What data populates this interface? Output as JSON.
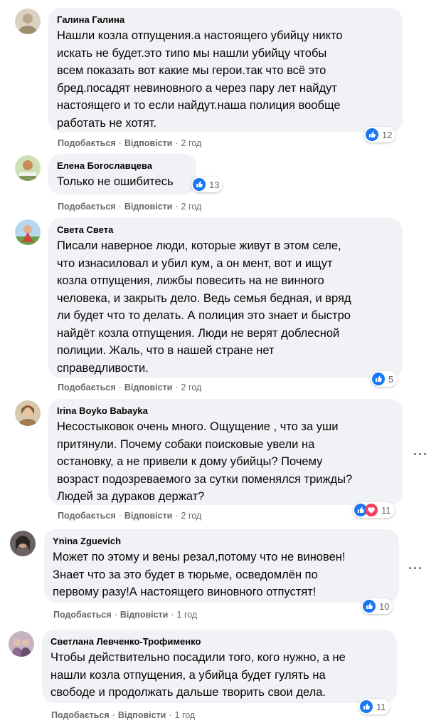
{
  "comments": [
    {
      "author": "Галина Галина",
      "text": "Нашли козла отпущения.а настоящего убийцу никто\nискать не будет.это типо мы нашли убийцу чтобы\nвсем показать вот какие мы герои.так что всё это\nбред.посадят невиновного а через пару лет найдут\nнастоящего и то если найдут.наша полиция вообще\nработать не хотят.",
      "like": "Подобається",
      "reply": "Відповісти",
      "time": "2 год",
      "reaction_count": "12",
      "avatar_color": "#b9a98a"
    },
    {
      "author": "Елена Богославцева",
      "text": "Только не ошибитесь",
      "like": "Подобається",
      "reply": "Відповісти",
      "time": "2 год",
      "reaction_count": "13",
      "avatar_color": "#7f9a5a"
    },
    {
      "author": "Света Света",
      "text": "Писали наверное люди, которые живут в этом селе,\nчто изнасиловал и убил кум, а он мент, вот и ищут\nкозла отпущения, лижбы повесить на не винного\nчеловека, и закрыть дело. Ведь семья бедная, и вряд\nли будет что то делать. А полиция это знает и быстро\nнайдёт козла отпущения. Люди не верят доблесной\nполиции. Жаль, что в нашей стране нет\nсправедливости.",
      "like": "Подобається",
      "reply": "Відповісти",
      "time": "2 год",
      "reaction_count": "5",
      "avatar_color": "#c94a3b"
    },
    {
      "author": "Irina Boyko Babayka",
      "text": "Несостыковок очень много. Ощущение , что за уши\nпритянули. Почему собаки поисковые увели на\nостановку, а не привели к дому убийцы? Почему\nвозраст подозреваемого за сутки поменялся трижды?\nЛюдей за дураков держат?",
      "like": "Подобається",
      "reply": "Відповісти",
      "time": "2 год",
      "reaction_count": "11",
      "avatar_color": "#a07a52"
    },
    {
      "author": "Ynina Zguevich",
      "text": "Может по этому и вены резал,потому что не виновен!\nЗнает что за это будет в тюрьме, осведомлён по\nпервому разу!А настоящего виновного отпустят!",
      "like": "Подобається",
      "reply": "Відповісти",
      "time": "1 год",
      "reaction_count": "10",
      "avatar_color": "#3d3a3a"
    },
    {
      "author": "Светлана Левченко-Трофименко",
      "text": "Чтобы действительно посадили того, кого нужно, а не\nнашли козла отпущения, а убийца будет гулять на\nсвободе и продолжать дальше творить свои дела.",
      "like": "Подобається",
      "reply": "Відповісти",
      "time": "1 год",
      "reaction_count": "11",
      "avatar_color": "#8a6a8c"
    }
  ],
  "colors": {
    "bubble": "#f0f2f5",
    "like_blue": "#1877f2",
    "love_red": "#f33e58",
    "meta_gray": "#65676b"
  },
  "icons": {
    "like": "like-reaction-icon",
    "love": "love-reaction-icon",
    "more": "more-options-icon"
  }
}
